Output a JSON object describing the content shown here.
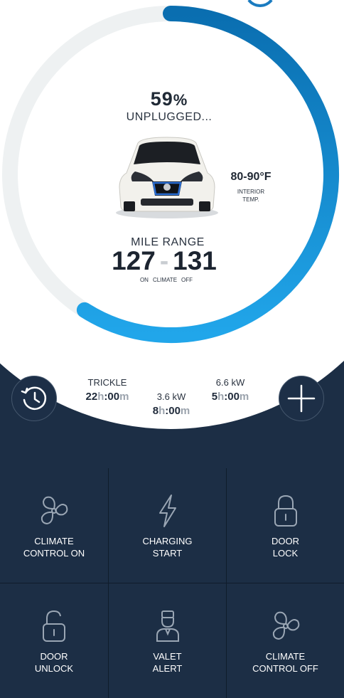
{
  "colors": {
    "background": "#1c2e45",
    "ring_track": "#eef1f2",
    "ring_progress_start": "#0a6eb0",
    "ring_progress_end": "#21a6ea",
    "text_dark": "#1c2430"
  },
  "battery": {
    "percent": 59,
    "percent_label": "59",
    "percent_unit": "%",
    "status": "UNPLUGGED..."
  },
  "interior": {
    "temp": "80-90°F",
    "label_line1": "INTERIOR",
    "label_line2": "TEMP."
  },
  "range": {
    "label": "MILE RANGE",
    "climate_on": "127",
    "climate_off": "131",
    "dash": "-",
    "on_label": "ON",
    "climate_label": "CLIMATE",
    "off_label": "OFF"
  },
  "charging": {
    "trickle": {
      "label": "TRICKLE",
      "h": "22",
      "m": "00"
    },
    "kw36": {
      "label": "3.6 kW",
      "h": "8",
      "m": "00"
    },
    "kw66": {
      "label": "6.6 kW",
      "h": "5",
      "m": "00"
    },
    "unit_h": "h",
    "unit_m": "m",
    "sep": ":"
  },
  "buttons": {
    "history_icon": "history-clock-icon",
    "add_icon": "plus-icon"
  },
  "tiles": [
    {
      "label": "CLIMATE\nCONTROL ON",
      "icon": "fan-icon"
    },
    {
      "label": "CHARGING\nSTART",
      "icon": "lightning-icon"
    },
    {
      "label": "DOOR\nLOCK",
      "icon": "lock-icon"
    },
    {
      "label": "DOOR\nUNLOCK",
      "icon": "unlock-icon"
    },
    {
      "label": "VALET\nALERT",
      "icon": "valet-icon"
    },
    {
      "label": "CLIMATE\nCONTROL OFF",
      "icon": "fan-icon"
    }
  ]
}
